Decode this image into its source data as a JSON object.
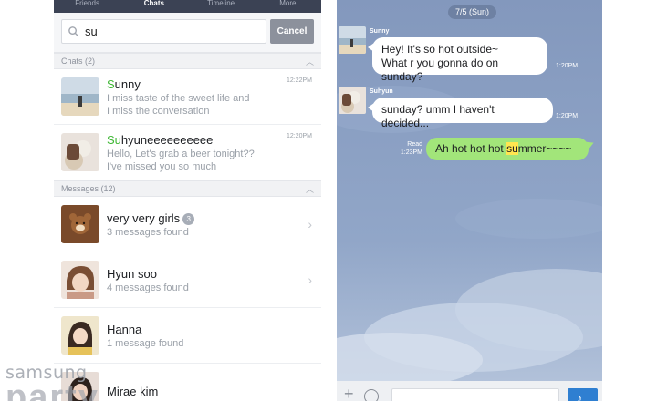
{
  "left": {
    "tabs": [
      "Friends",
      "Chats",
      "Timeline",
      "More"
    ],
    "search": {
      "value": "su",
      "cancel_label": "Cancel"
    },
    "chats_section": {
      "title": "Chats (2)"
    },
    "chats": [
      {
        "name_highlight": "S",
        "name_rest": "unny",
        "line1": "I miss taste of the sweet life and",
        "line2": "I miss the conversation",
        "time": "12:22PM"
      },
      {
        "name_highlight": "Su",
        "name_rest": "hyuneeeeeeeeee",
        "line1": "Hello, Let's grab a beer tonight??",
        "line2": "I've missed you so much",
        "time": "12:20PM"
      }
    ],
    "messages_section": {
      "title": "Messages (12)"
    },
    "messages": [
      {
        "name": "very very girls",
        "badge": "3",
        "sub": "3 messages found"
      },
      {
        "name": "Hyun soo",
        "sub": "4 messages found"
      },
      {
        "name": "Hanna",
        "sub": "1 message found"
      },
      {
        "name": "Mirae kim"
      }
    ]
  },
  "right": {
    "date": "7/5 (Sun)",
    "msg1": {
      "sender": "Sunny",
      "text1": "Hey! It's so hot outside~",
      "text2": "What r you gonna do on sunday?",
      "time": "1:20PM"
    },
    "msg2": {
      "sender": "Suhyun",
      "text": "sunday? umm I haven't decided...",
      "time": "1:20PM"
    },
    "msg3": {
      "pre": "Ah hot hot hot ",
      "hl": "su",
      "post": "mmer~~~~",
      "read": "Read",
      "time": "1:23PM"
    },
    "input": {
      "plus": "+",
      "send_icon": "mic-icon"
    }
  },
  "watermark": {
    "line1": "samsung",
    "line2": "party"
  },
  "colors": {
    "accent_green": "#40b836",
    "bubble_green": "#a2e57a",
    "chat_bg": "#8ea2c4",
    "tab_bar": "#3b4254",
    "send_blue": "#2f7fd1"
  }
}
